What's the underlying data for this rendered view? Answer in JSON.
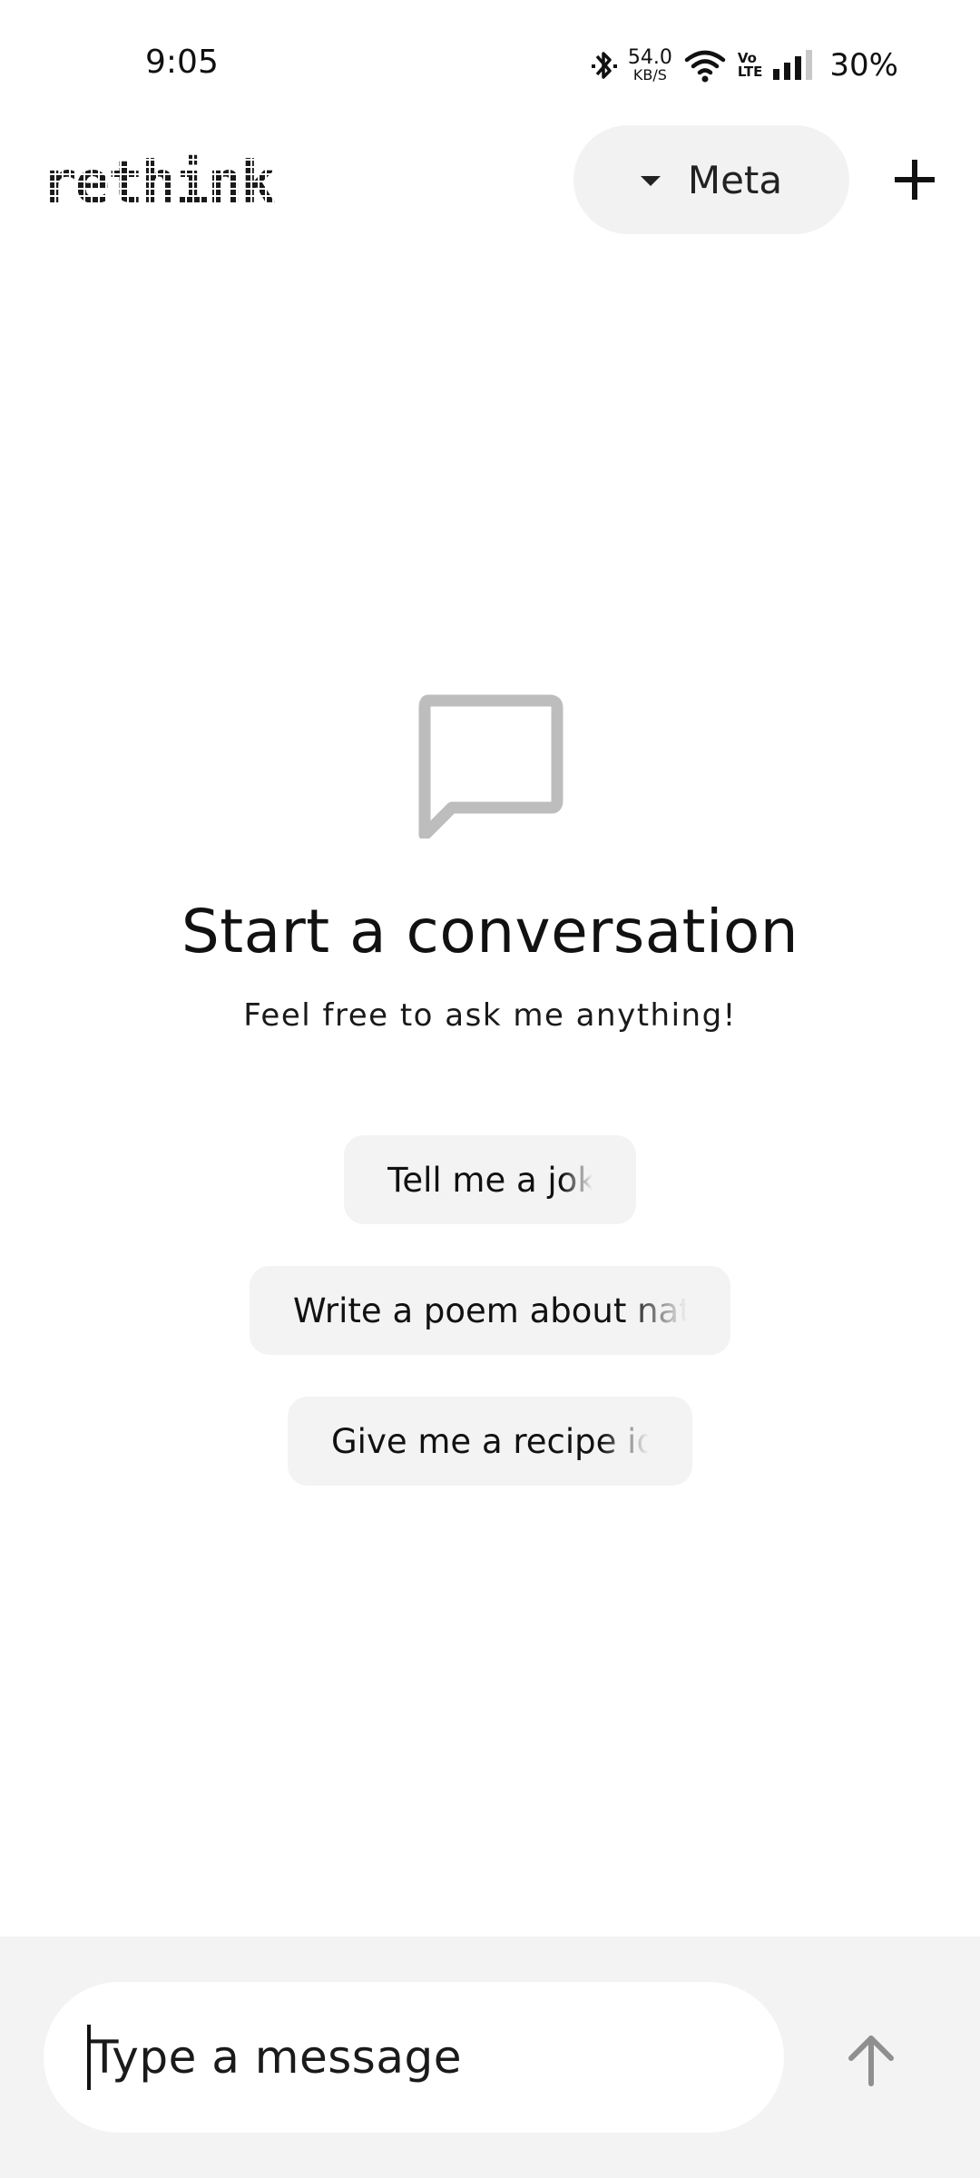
{
  "status_bar": {
    "time": "9:05",
    "net_speed_value": "54.0",
    "net_speed_unit": "KB/S",
    "volte_top": "Vo",
    "volte_bottom": "LTE",
    "battery": "30%",
    "icons": [
      "bluetooth-icon",
      "wifi-icon",
      "signal-icon"
    ]
  },
  "header": {
    "logo": "rethink",
    "model_selector": {
      "label": "Meta",
      "icon": "caret-down-icon"
    },
    "new_chat_icon": "plus-icon"
  },
  "empty_state": {
    "icon": "chat-bubble-icon",
    "title": "Start a conversation",
    "subtitle": "Feel free to ask me anything!",
    "suggestions": [
      "Tell me a joke",
      "Write a poem about nature",
      "Give me a recipe idea"
    ]
  },
  "composer": {
    "placeholder": "Type a message",
    "send_icon": "arrow-up-icon"
  },
  "colors": {
    "background": "#ffffff",
    "chip_background": "#f3f3f3",
    "composer_background": "#f3f3f3",
    "icon_gray": "#bdbdbd",
    "send_disabled": "#8f8f8f"
  }
}
